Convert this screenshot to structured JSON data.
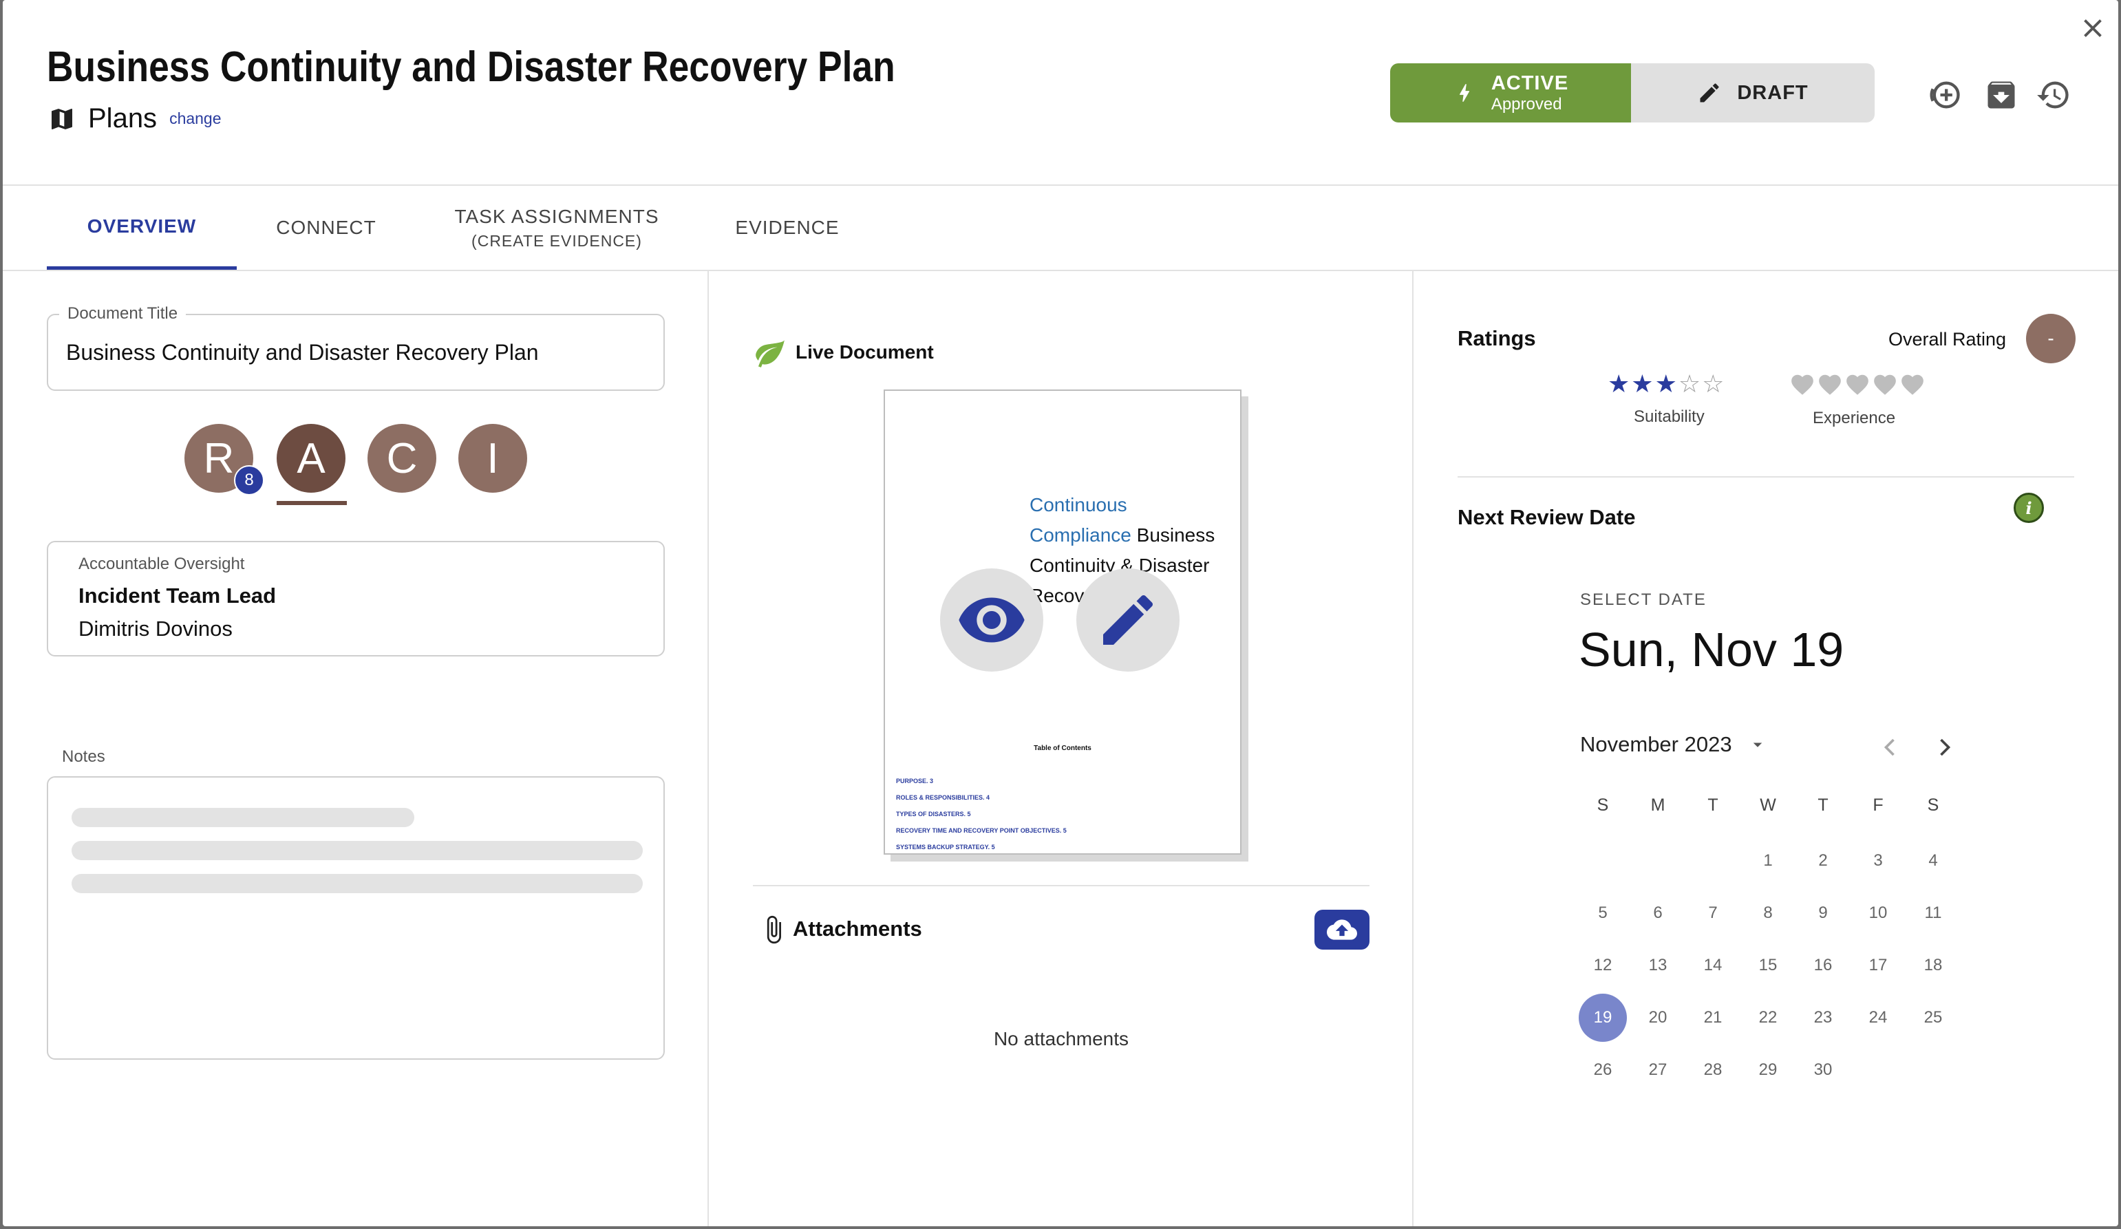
{
  "header": {
    "title": "Business Continuity and Disaster Recovery Plan",
    "category": "Plans",
    "change_link": "change",
    "status_active": "ACTIVE",
    "status_approved": "Approved",
    "status_draft": "DRAFT"
  },
  "tabs": [
    {
      "label": "OVERVIEW"
    },
    {
      "label": "CONNECT"
    },
    {
      "label": "TASK ASSIGNMENTS",
      "sub": "(CREATE EVIDENCE)"
    },
    {
      "label": "EVIDENCE"
    }
  ],
  "overview": {
    "doc_title_label": "Document Title",
    "doc_title_value": "Business Continuity and Disaster Recovery Plan",
    "raci": [
      "R",
      "A",
      "C",
      "I"
    ],
    "raci_badge": "8",
    "oversight_label": "Accountable Oversight",
    "oversight_role": "Incident Team Lead",
    "oversight_person": "Dimitris Dovinos",
    "notes_label": "Notes"
  },
  "document": {
    "live_label": "Live Document",
    "cover_line1": "Continuous",
    "cover_line2a": "Compliance",
    "cover_line2b": " Business",
    "cover_line3": "Continuity & Disaster",
    "cover_line4": "Recovery Plan",
    "toc_title": "Table of Contents",
    "toc_items": [
      "PURPOSE. 3",
      "ROLES & RESPONSIBILITIES. 4",
      "TYPES OF DISASTERS. 5",
      "RECOVERY TIME AND RECOVERY POINT OBJECTIVES. 5",
      "SYSTEMS BACKUP STRATEGY. 5"
    ],
    "attachments_label": "Attachments",
    "no_attachments": "No attachments"
  },
  "ratings": {
    "title": "Ratings",
    "overall_label": "Overall Rating",
    "overall_value": "-",
    "suitability_label": "Suitability",
    "suitability_stars": 3,
    "experience_label": "Experience",
    "experience_hearts": 0,
    "max": 5
  },
  "review": {
    "title": "Next Review Date",
    "select_label": "SELECT DATE",
    "selected_display": "Sun, Nov 19",
    "month_label": "November 2023",
    "weekdays": [
      "S",
      "M",
      "T",
      "W",
      "T",
      "F",
      "S"
    ],
    "first_weekday": 3,
    "days_in_month": 30,
    "selected_day": 19
  },
  "colors": {
    "accent": "#2a3c9e",
    "active_green": "#6f9a3c",
    "raci_brown": "#8d6e63"
  }
}
